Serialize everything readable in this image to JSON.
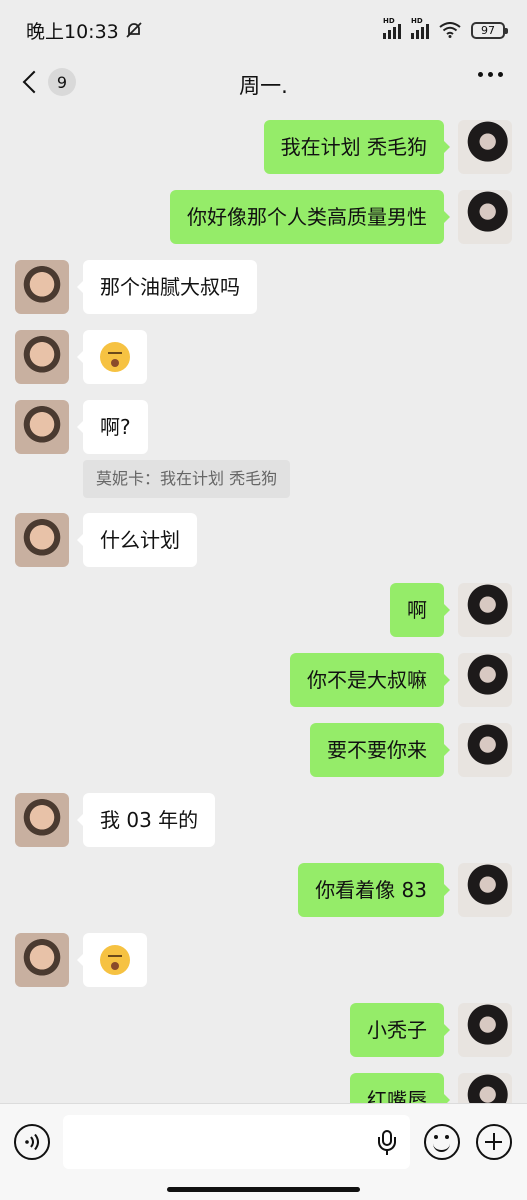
{
  "status_bar": {
    "time": "晚上10:33",
    "network_1": "HD",
    "network_2": "HD",
    "battery": "97"
  },
  "header": {
    "unread_count": "9",
    "title": "周一."
  },
  "messages": [
    {
      "side": "right",
      "text": "我在计划 秃毛狗"
    },
    {
      "side": "right",
      "text": "你好像那个人类高质量男性"
    },
    {
      "side": "left",
      "text": "那个油腻大叔吗"
    },
    {
      "side": "left",
      "emoji": "sleepy-face-emoji"
    },
    {
      "side": "left",
      "text": "啊?"
    },
    {
      "side": "left",
      "text": "什么计划"
    },
    {
      "side": "right",
      "text": "啊"
    },
    {
      "side": "right",
      "text": "你不是大叔嘛"
    },
    {
      "side": "right",
      "text": "要不要你来"
    },
    {
      "side": "left",
      "text": "我 03 年的"
    },
    {
      "side": "right",
      "text": "你看着像 83"
    },
    {
      "side": "left",
      "emoji": "thinking-face-emoji"
    },
    {
      "side": "right",
      "text": "小秃子"
    },
    {
      "side": "right",
      "text": "红嘴唇"
    }
  ],
  "quote": {
    "text": "莫妮卡：我在计划 秃毛狗"
  },
  "input": {
    "value": ""
  },
  "colors": {
    "sent_bubble": "#95ec69",
    "received_bubble": "#ffffff",
    "background": "#ededed"
  }
}
